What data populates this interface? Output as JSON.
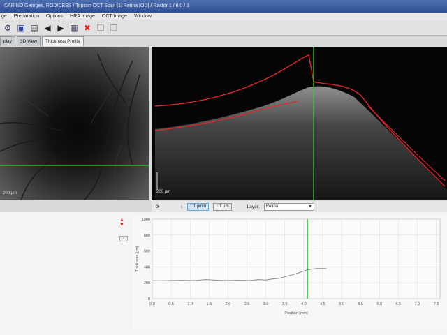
{
  "window": {
    "title": "CARINO Georges, ROD/CESS / Topcon OCT Scan [1] Retina [OD] / Rastor 1 / 6.0 / 1"
  },
  "menu": [
    "ge",
    "Preparation",
    "Options",
    "HRA Image",
    "OCT Image",
    "Window"
  ],
  "toolbar": {
    "icons": [
      "wrench-icon",
      "save-icon",
      "film-icon",
      "arrow-left-icon",
      "arrow-right-icon",
      "grid-icon",
      "close-icon",
      "copy-icon",
      "paste-icon"
    ]
  },
  "tabs": [
    {
      "label": "play",
      "active": false
    },
    {
      "label": "3D View",
      "active": false
    },
    {
      "label": "Thickness Profile",
      "active": true
    }
  ],
  "fundus": {
    "scale_label": "200 µm"
  },
  "bscan": {
    "scale_label": "200 µm"
  },
  "controls": {
    "zoom_a": "1:1 µmm",
    "zoom_b": "1:1 µm",
    "layer_label": "Layer:",
    "layer_value": "Retina"
  },
  "chart_data": {
    "type": "line",
    "xlabel": "Position [mm]",
    "ylabel": "Thickness [µm]",
    "xlim": [
      0,
      7.6
    ],
    "ylim": [
      0,
      1000
    ],
    "xticks": [
      "0.0",
      "0.5",
      "1.0",
      "1.5",
      "2.0",
      "2.5",
      "3.0",
      "3.5",
      "4.0",
      "4.5",
      "5.0",
      "5.5",
      "6.0",
      "6.5",
      "7.0",
      "7.5"
    ],
    "yticks": [
      "0",
      "200",
      "400",
      "600",
      "800",
      "1000"
    ],
    "series": [
      {
        "values": [
          [
            0.0,
            225
          ],
          [
            0.3,
            225
          ],
          [
            0.5,
            228
          ],
          [
            0.8,
            232
          ],
          [
            1.0,
            228
          ],
          [
            1.2,
            230
          ],
          [
            1.4,
            240
          ],
          [
            1.6,
            235
          ],
          [
            1.8,
            230
          ],
          [
            2.0,
            228
          ],
          [
            2.2,
            232
          ],
          [
            2.4,
            230
          ],
          [
            2.6,
            228
          ],
          [
            2.8,
            240
          ],
          [
            3.0,
            235
          ],
          [
            3.2,
            250
          ],
          [
            3.35,
            255
          ],
          [
            3.5,
            275
          ],
          [
            3.7,
            300
          ],
          [
            3.9,
            330
          ],
          [
            4.05,
            355
          ],
          [
            4.2,
            370
          ],
          [
            4.35,
            380
          ],
          [
            4.5,
            380
          ],
          [
            4.6,
            378
          ]
        ],
        "color": "#8a8a8a"
      }
    ],
    "marker_x": 4.1,
    "marker_color": "#33cc33",
    "grid": true
  },
  "colors": {
    "accent_green": "#33cc33",
    "boundary_red": "#e0282a"
  }
}
